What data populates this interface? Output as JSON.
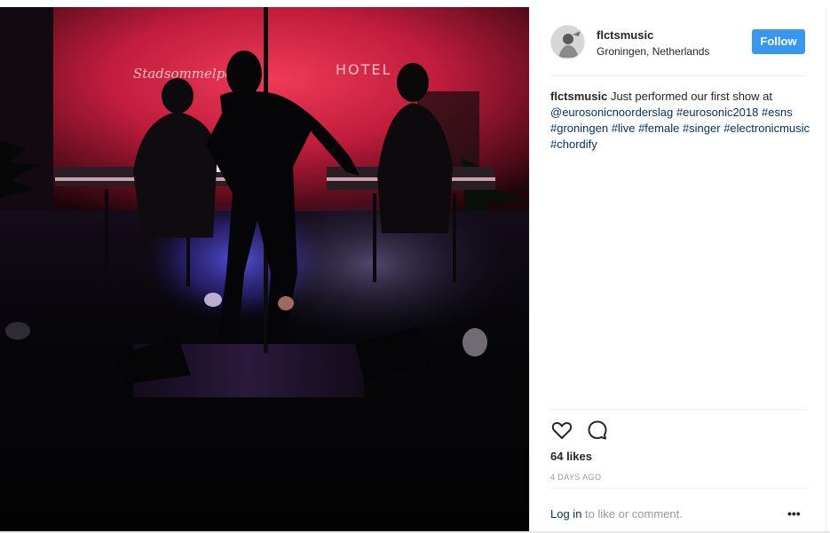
{
  "post": {
    "image_alt": "",
    "username": "flctsmusic",
    "location": "Groningen, Netherlands",
    "follow_label": "Follow",
    "caption": {
      "author": "flctsmusic",
      "text": "Just performed our first show at",
      "mention": "@eurosonicnoorderslag",
      "hashtags": [
        "#eurosonic2018",
        "#esns",
        "#groningen",
        "#live",
        "#female",
        "#singer",
        "#electronicmusic",
        "#chordify"
      ]
    },
    "likes": "64 likes",
    "time_ago": "4 DAYS AGO",
    "login": {
      "link": "Log in",
      "rest": "to like or comment."
    },
    "more_label": "•••"
  },
  "icons": {
    "like": "heart-outline-icon",
    "comment": "comment-bubble-icon",
    "more": "more-options-icon"
  },
  "colors": {
    "follow_bg": "#3897f0",
    "link": "#003569",
    "muted": "#999999",
    "text": "#262626"
  },
  "photo_text": {
    "neon_left": "Stadsommelpe",
    "neon_hotel": "HOTEL"
  }
}
